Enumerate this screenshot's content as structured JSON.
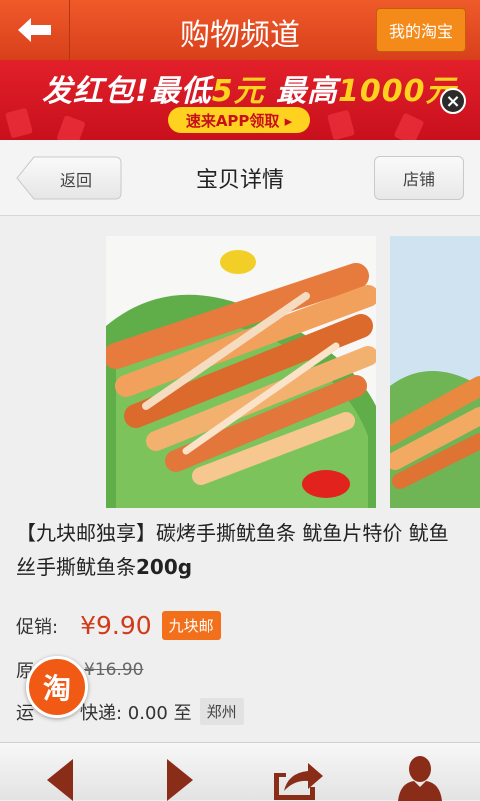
{
  "topbar": {
    "title": "购物频道",
    "my_taobao_label": "我的淘宝"
  },
  "banner": {
    "text_part1": "发红包!最低",
    "text_hl1": "5元",
    "text_part2": " 最高",
    "text_hl2": "1000元",
    "cta": "速来APP领取 ▸",
    "close": "×"
  },
  "subheader": {
    "back_label": "返回",
    "title": "宝贝详情",
    "shop_label": "店铺"
  },
  "product": {
    "title": "【九块邮独享】碳烤手撕鱿鱼条 鱿鱼片特价 鱿鱼丝手撕鱿鱼条",
    "title_weight": "200g",
    "promo_label": "促销:",
    "promo_price": "¥9.90",
    "promo_tag": "九块邮",
    "orig_label": "原",
    "orig_price": "¥16.90",
    "ship_label": "运",
    "ship_value": "快递: 0.00 至",
    "ship_city": "郑州"
  },
  "float_badge": "淘",
  "colors": {
    "accent": "#ef5a2a",
    "price": "#d23b1a",
    "tag": "#f2701b",
    "banner": "#e2202a"
  }
}
